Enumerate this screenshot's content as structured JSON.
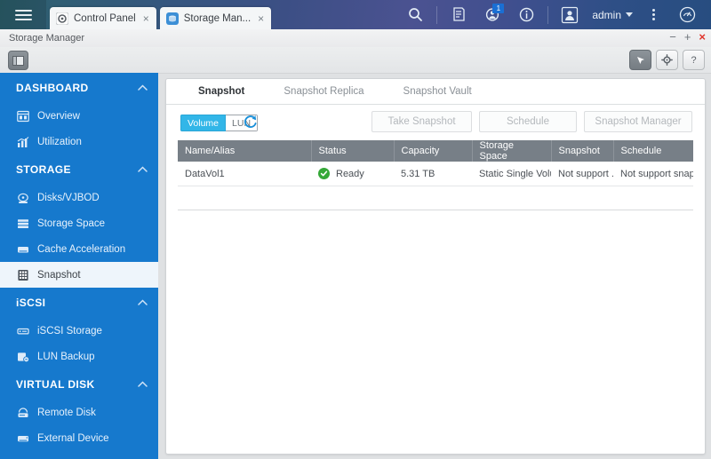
{
  "topbar": {
    "menu_icon": "hamburger-icon",
    "tabs": [
      {
        "label": "Control Panel",
        "icon": "gear-icon",
        "close": "×",
        "active": false
      },
      {
        "label": "Storage Man...",
        "icon": "storage-icon",
        "close": "×",
        "active": true
      }
    ],
    "icons": [
      {
        "name": "search-icon"
      },
      {
        "name": "notes-icon"
      },
      {
        "name": "user-notification-icon",
        "badge": "1"
      },
      {
        "name": "info-icon"
      },
      {
        "name": "avatar-icon"
      }
    ],
    "admin_label": "admin",
    "overflow_icon": "vertical-dots-icon",
    "dashboard_icon": "gauge-icon"
  },
  "window": {
    "title": "Storage Manager",
    "minimize": "−",
    "maximize": "+",
    "close": "×",
    "toolbar_buttons": [
      {
        "name": "pointer-button",
        "glyph": "✐"
      },
      {
        "name": "settings-button",
        "glyph": "⚙"
      },
      {
        "name": "help-button",
        "glyph": "?"
      }
    ],
    "view_button": "panel-view-button"
  },
  "sidebar": {
    "groups": [
      {
        "label": "DASHBOARD",
        "caret": "⌃",
        "items": [
          {
            "label": "Overview",
            "icon": "overview-icon",
            "active": false
          },
          {
            "label": "Utilization",
            "icon": "chart-icon",
            "active": false
          }
        ]
      },
      {
        "label": "STORAGE",
        "caret": "⌃",
        "items": [
          {
            "label": "Disks/VJBOD",
            "icon": "disk-icon",
            "active": false
          },
          {
            "label": "Storage Space",
            "icon": "storage-space-icon",
            "active": false
          },
          {
            "label": "Cache Acceleration",
            "icon": "cache-icon",
            "active": false
          },
          {
            "label": "Snapshot",
            "icon": "snapshot-icon",
            "active": true
          }
        ]
      },
      {
        "label": "iSCSI",
        "caret": "⌃",
        "items": [
          {
            "label": "iSCSI Storage",
            "icon": "iscsi-icon",
            "active": false
          },
          {
            "label": "LUN Backup",
            "icon": "lun-backup-icon",
            "active": false
          }
        ]
      },
      {
        "label": "VIRTUAL DISK",
        "caret": "⌃",
        "items": [
          {
            "label": "Remote Disk",
            "icon": "remote-disk-icon",
            "active": false
          },
          {
            "label": "External Device",
            "icon": "external-device-icon",
            "active": false
          }
        ]
      }
    ]
  },
  "main": {
    "tabs": [
      {
        "label": "Snapshot",
        "active": true
      },
      {
        "label": "Snapshot Replica",
        "active": false
      },
      {
        "label": "Snapshot Vault",
        "active": false
      }
    ],
    "toggle": {
      "volume": "Volume",
      "lun": "LUN",
      "selected": "Volume"
    },
    "refresh_icon": "refresh-icon",
    "buttons": [
      {
        "label": "Take Snapshot",
        "disabled": true
      },
      {
        "label": "Schedule",
        "disabled": true
      },
      {
        "label": "Snapshot Manager",
        "disabled": true
      }
    ],
    "table": {
      "columns": [
        "Name/Alias",
        "Status",
        "Capacity",
        "Storage Space",
        "Snapshot",
        "Schedule"
      ],
      "rows": [
        {
          "name": "DataVol1",
          "status": "Ready",
          "status_icon": "check-circle-icon",
          "capacity": "5.31 TB",
          "storage_space": "Static Single Volu...",
          "snapshot": "Not support ...",
          "schedule": "Not support snap..."
        }
      ]
    }
  },
  "colors": {
    "sidebar_blue": "#1679cd",
    "accent_cyan": "#32b6e8",
    "status_green": "#35a838",
    "header_gray": "#777f87",
    "close_red": "#e0342a"
  }
}
